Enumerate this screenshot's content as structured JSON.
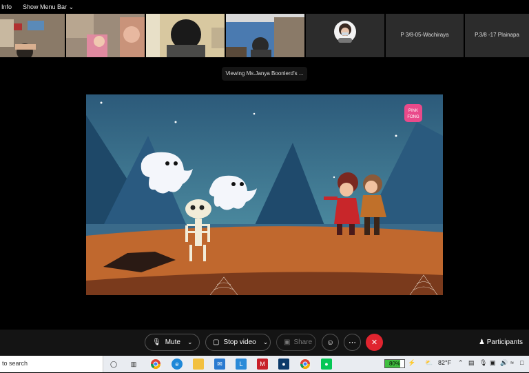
{
  "menubar": {
    "info": "Info",
    "show_menu_bar": "Show Menu Bar"
  },
  "participants_strip": [
    {
      "type": "video"
    },
    {
      "type": "video"
    },
    {
      "type": "video"
    },
    {
      "type": "video"
    },
    {
      "type": "avatar"
    },
    {
      "type": "name",
      "label": "P 3/8-05-Wachiraya"
    },
    {
      "type": "name",
      "label": "P.3/8 -17 Plainapa"
    }
  ],
  "viewing_banner": "Viewing Ms.Janya Boonlerd's ...",
  "shared_video": {
    "logo_text": "PINK FONG",
    "logo_text_top": "PINK",
    "logo_text_bottom": "FONG"
  },
  "controls": {
    "mute_label": "Mute",
    "stop_video_label": "Stop video",
    "share_label": "Share",
    "participants_label": "Participants"
  },
  "taskbar": {
    "search_placeholder": "to search",
    "battery_label": "80%",
    "battery_level": 0.8,
    "temperature": "82°F"
  },
  "colors": {
    "end_call": "#e0242f",
    "battery": "#3fbf3f"
  }
}
